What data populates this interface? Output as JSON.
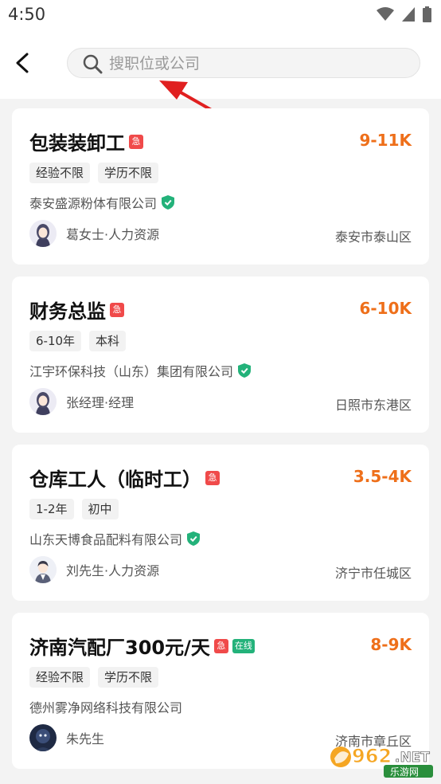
{
  "status_bar": {
    "time": "4:50"
  },
  "header": {
    "search_placeholder": "搜职位或公司"
  },
  "jobs": [
    {
      "title": "包装装卸工",
      "urgent": "急",
      "salary": "9-11K",
      "tags": [
        "经验不限",
        "学历不限"
      ],
      "company": "泰安盛源粉体有限公司",
      "recruiter": "葛女士·人力资源",
      "location": "泰安市泰山区"
    },
    {
      "title": "财务总监",
      "urgent": "急",
      "salary": "6-10K",
      "tags": [
        "6-10年",
        "本科"
      ],
      "company": "江宇环保科技（山东）集团有限公司",
      "recruiter": "张经理·经理",
      "location": "日照市东港区"
    },
    {
      "title": "仓库工人（临时工）",
      "urgent": "急",
      "salary": "3.5-4K",
      "tags": [
        "1-2年",
        "初中"
      ],
      "company": "山东天博食品配料有限公司",
      "recruiter": "刘先生·人力资源",
      "location": "济宁市任城区"
    },
    {
      "title": "济南汽配厂300元/天",
      "urgent": "急",
      "online": "在线",
      "salary": "8-9K",
      "tags": [
        "经验不限",
        "学历不限"
      ],
      "company": "德州雾净网络科技有限公司",
      "recruiter": "朱先生",
      "location": "济南市章丘区"
    }
  ],
  "watermark": {
    "brand": "962.NET",
    "sub": "乐游网"
  },
  "colors": {
    "salary": "#ee6f1a",
    "urgent": "#f04a4a",
    "verified": "#23b27a",
    "annotation_arrow": "#e02020"
  }
}
